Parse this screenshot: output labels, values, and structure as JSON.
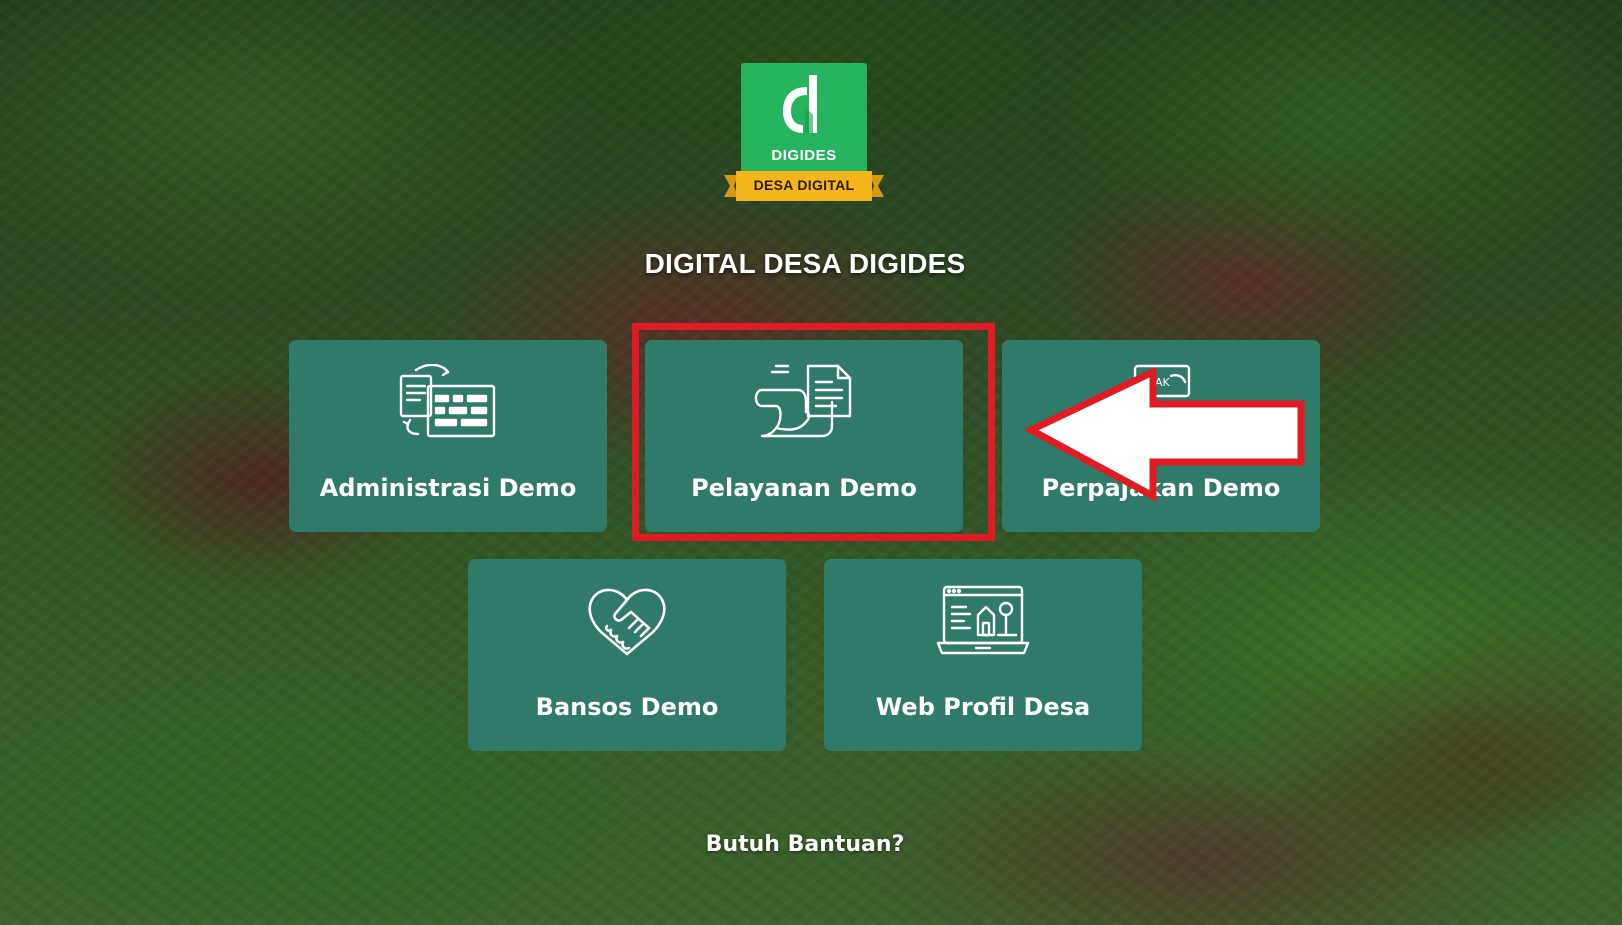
{
  "branding": {
    "logo_name": "DIGIDES",
    "logo_ribbon": "DESA DIGITAL",
    "logo_color": "#27b45e",
    "ribbon_color": "#f5b51d"
  },
  "page_title": "DIGITAL DESA DIGIDES",
  "menu": {
    "items": [
      {
        "label": "Administrasi Demo",
        "icon": "document-transfer-icon"
      },
      {
        "label": "Pelayanan Demo",
        "icon": "scroll-document-icon"
      },
      {
        "label": "Perpajakan Demo",
        "icon": "tax-card-icon"
      },
      {
        "label": "Bansos Demo",
        "icon": "heart-handshake-icon"
      },
      {
        "label": "Web Profil Desa",
        "icon": "laptop-web-icon"
      }
    ]
  },
  "help": {
    "label": "Butuh Bantuan?"
  },
  "colors": {
    "card": "#2f7a68",
    "annotation_red": "#e01b24"
  }
}
